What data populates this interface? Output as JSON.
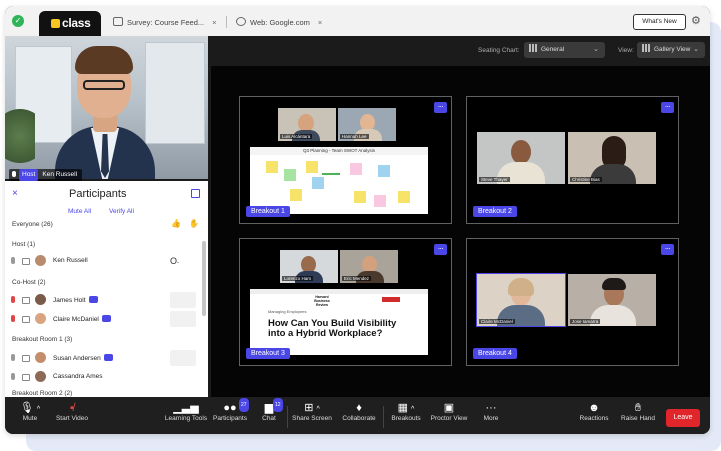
{
  "browser": {
    "app_logo": "class",
    "tabs": [
      {
        "label": "Survey: Course Feed...",
        "close": "×"
      },
      {
        "label": "Web: Google.com",
        "close": "×"
      }
    ],
    "whats_new": "What's New"
  },
  "controls": {
    "seating_label": "Seating Chart:",
    "seating_value": "General",
    "view_label": "View:",
    "view_value": "Gallery View"
  },
  "host_video": {
    "badge": "Host",
    "name": "Ken Russell"
  },
  "participants": {
    "close": "×",
    "title": "Participants",
    "mute_all": "Mute All",
    "verify_all": "Verify All",
    "sections": [
      {
        "label": "Everyone (26)"
      },
      {
        "label": "Host (1)",
        "people": [
          {
            "name": "Ken Russell"
          }
        ]
      },
      {
        "label": "Co-Host (2)",
        "people": [
          {
            "name": "James Holt"
          },
          {
            "name": "Claire McDaniel"
          }
        ]
      },
      {
        "label": "Breakout Room 1 (3)",
        "people": [
          {
            "name": "Susan Andersen"
          },
          {
            "name": "Cassandra Ames"
          }
        ]
      },
      {
        "label": "Breakout Room 2 (2)"
      }
    ]
  },
  "breakouts": [
    {
      "label": "Breakout 1",
      "thumbs": [
        "Luis Alcántara",
        "Hannah Lee"
      ],
      "share_title": "Q3 Planning - Team SWOT Analysis"
    },
    {
      "label": "Breakout 2",
      "thumbs": [
        "Steve Thayer",
        "Christine Bias"
      ]
    },
    {
      "label": "Breakout 3",
      "thumbs": [
        "Lorenzo Ham",
        "Eric Mendez"
      ],
      "share_kicker": "Managing Employees",
      "share_brand": "Harvard Business Review",
      "share_headline": "How Can You Build Visibility into a Hybrid Workplace?"
    },
    {
      "label": "Breakout 4",
      "thumbs": [
        "Claire McDaniel",
        "Jose Iamarra"
      ]
    }
  ],
  "toolbar": {
    "mute": "Mute",
    "start_video": "Start Video",
    "learning_tools": "Learning Tools",
    "participants": "Participants",
    "participants_count": "27",
    "chat": "Chat",
    "chat_count": "12",
    "share_screen": "Share Screen",
    "collaborate": "Collaborate",
    "breakouts": "Breakouts",
    "proctor_view": "Proctor View",
    "more": "More",
    "reactions": "Reactions",
    "raise_hand": "Raise Hand",
    "leave": "Leave"
  }
}
